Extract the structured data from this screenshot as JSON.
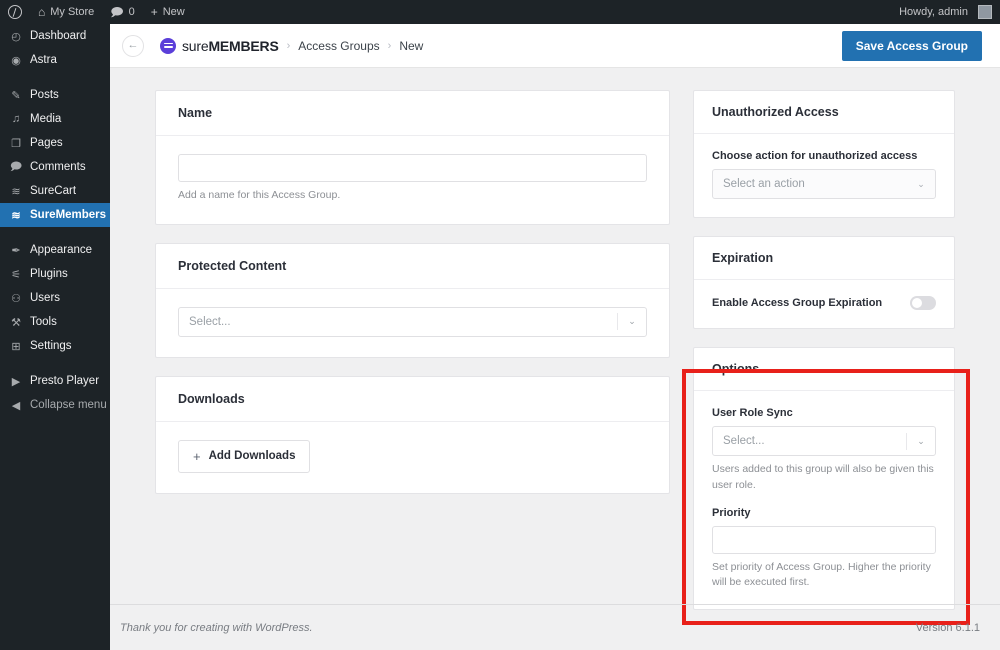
{
  "adminbar": {
    "wp_logo": "wordpress-logo-icon",
    "site_name": "My Store",
    "home_icon": "⌂",
    "comment_icon": "🗩",
    "comment_count": "0",
    "plus_icon": "+",
    "new_label": "New",
    "greeting": "Howdy, admin"
  },
  "sidebar": {
    "items": [
      {
        "label": "Dashboard",
        "icon": "◴",
        "name": "dashboard",
        "current": false
      },
      {
        "label": "Astra",
        "icon": "◉",
        "name": "astra",
        "current": false
      },
      {
        "gap": true
      },
      {
        "label": "Posts",
        "icon": "✎",
        "name": "posts",
        "current": false
      },
      {
        "label": "Media",
        "icon": "♫",
        "name": "media",
        "current": false
      },
      {
        "label": "Pages",
        "icon": "❐",
        "name": "pages",
        "current": false
      },
      {
        "label": "Comments",
        "icon": "🗩",
        "name": "comments",
        "current": false
      },
      {
        "label": "SureCart",
        "icon": "≋",
        "name": "surecart",
        "current": false
      },
      {
        "label": "SureMembers",
        "icon": "≋",
        "name": "suremembers",
        "current": true
      },
      {
        "gap": true
      },
      {
        "label": "Appearance",
        "icon": "✒",
        "name": "appearance",
        "current": false
      },
      {
        "label": "Plugins",
        "icon": "⚟",
        "name": "plugins",
        "current": false
      },
      {
        "label": "Users",
        "icon": "⚇",
        "name": "users",
        "current": false
      },
      {
        "label": "Tools",
        "icon": "⚒",
        "name": "tools",
        "current": false
      },
      {
        "label": "Settings",
        "icon": "⊞",
        "name": "settings",
        "current": false
      },
      {
        "gap": true
      },
      {
        "label": "Presto Player",
        "icon": "▶",
        "name": "presto-player",
        "current": false
      },
      {
        "label": "Collapse menu",
        "icon": "◀",
        "name": "collapse-menu",
        "current": false,
        "dim": true
      }
    ]
  },
  "header": {
    "back_icon": "←",
    "brand_light": "sure",
    "brand_bold": "MEMBERS",
    "separator": "›",
    "breadcrumb": [
      "Access Groups",
      "New"
    ],
    "save_label": "Save Access Group",
    "accent_color": "#2271b1",
    "brand_color": "#5b3fd9"
  },
  "main": {
    "name_card": {
      "title": "Name",
      "input_value": "",
      "input_placeholder": "",
      "help": "Add a name for this Access Group."
    },
    "protected_card": {
      "title": "Protected Content",
      "select_value": "Select...",
      "chevron": "⌄"
    },
    "downloads_card": {
      "title": "Downloads",
      "button_label": "Add Downloads",
      "plus": "+"
    }
  },
  "side": {
    "unauthorized_card": {
      "title": "Unauthorized Access",
      "field_label": "Choose action for unauthorized access",
      "select_value": "Select an action",
      "chevron": "⌄"
    },
    "expiration_card": {
      "title": "Expiration",
      "toggle_label": "Enable Access Group Expiration",
      "toggle_state": "off"
    },
    "options_card": {
      "title": "Options",
      "user_role_label": "User Role Sync",
      "user_role_value": "Select...",
      "user_role_help": "Users added to this group will also be given this user role.",
      "priority_label": "Priority",
      "priority_value": "",
      "priority_help": "Set priority of Access Group. Higher the priority will be executed first.",
      "chevron": "⌄"
    }
  },
  "annotation": {
    "highlight_color": "#e8201a",
    "target": "options-card"
  },
  "footer": {
    "thanks": "Thank you for creating with WordPress.",
    "version": "Version 6.1.1"
  }
}
